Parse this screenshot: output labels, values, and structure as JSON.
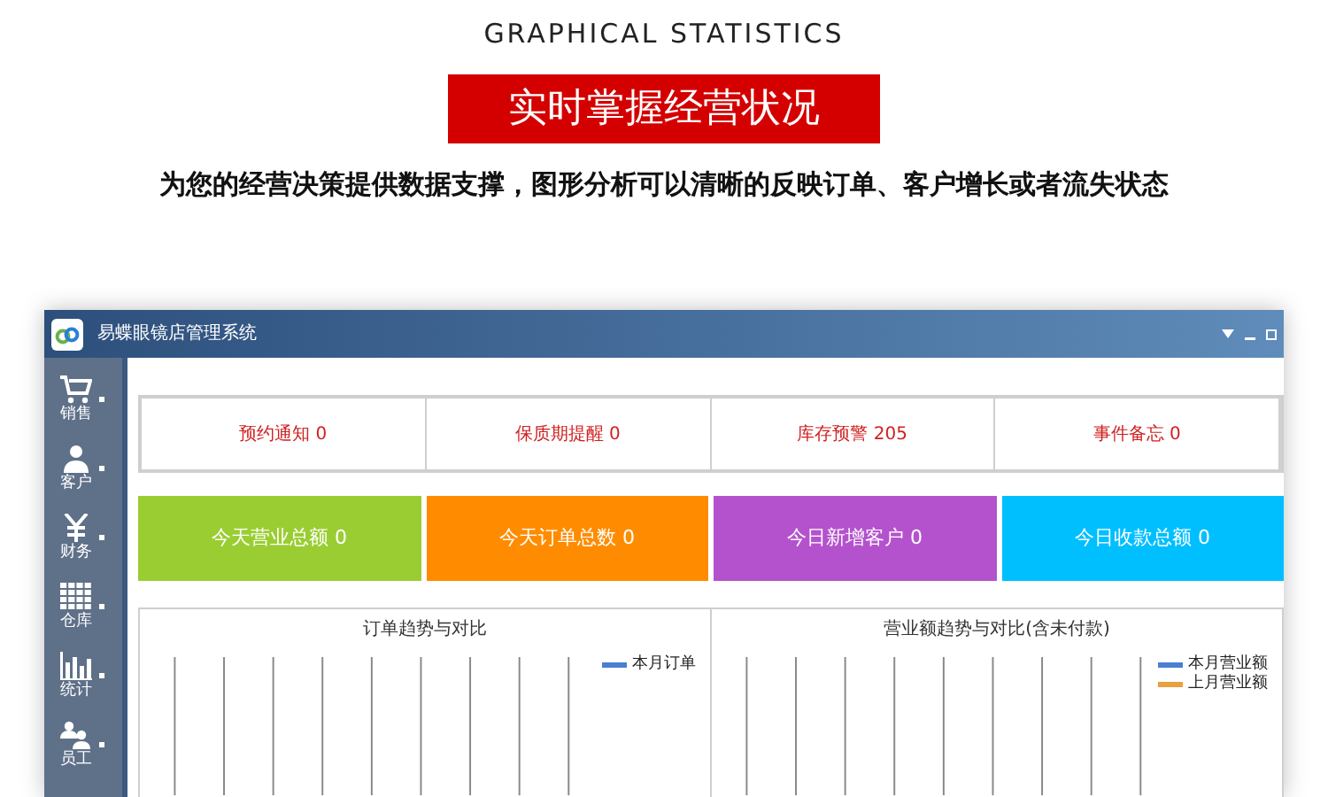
{
  "header": {
    "subheading": "GRAPHICAL STATISTICS",
    "banner": "实时掌握经营状况",
    "description": "为您的经营决策提供数据支撑，图形分析可以清晰的反映订单、客户增长或者流失状态"
  },
  "window": {
    "title": "易蝶眼镜店管理系统"
  },
  "sidebar": {
    "items": [
      {
        "kind": "cart",
        "label": "销售"
      },
      {
        "kind": "person",
        "label": "客户"
      },
      {
        "kind": "yen",
        "label": "财务"
      },
      {
        "kind": "grid",
        "label": "仓库"
      },
      {
        "kind": "bars",
        "label": "统计"
      },
      {
        "kind": "people",
        "label": "员工"
      }
    ]
  },
  "notices": [
    "预约通知 0",
    "保质期提醒 0",
    "库存预警 205",
    "事件备忘 0"
  ],
  "tiles": [
    {
      "label": "今天营业总额 0",
      "color": "#9acd32"
    },
    {
      "label": "今天订单总数 0",
      "color": "#ff8c00"
    },
    {
      "label": "今日新增客户 0",
      "color": "#b452cd"
    },
    {
      "label": "今日收款总额 0",
      "color": "#00bfff"
    }
  ],
  "charts": [
    {
      "title": "订单趋势与对比",
      "legend": [
        {
          "label": "本月订单",
          "color": "#4a7fd4"
        }
      ]
    },
    {
      "title": "营业额趋势与对比(含未付款)",
      "legend": [
        {
          "label": "本月营业额",
          "color": "#4a7fd4"
        },
        {
          "label": "上月营业额",
          "color": "#e8a040"
        }
      ]
    }
  ]
}
